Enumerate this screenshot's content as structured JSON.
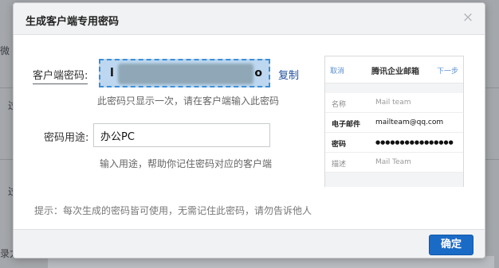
{
  "background": {
    "fragments": [
      "微",
      "过",
      "过",
      "录力"
    ],
    "bottom_texts": [
      "",
      "",
      ""
    ]
  },
  "dialog": {
    "title": "生成客户端专用密码",
    "close_glyph": "×",
    "password": {
      "label": "客户端密码:",
      "visible_first": "l",
      "visible_last": "o",
      "copy_label": "复制",
      "hint": "此密码只显示一次，请在客户端输入此密码"
    },
    "purpose": {
      "label": "密码用途:",
      "value": "办公PC",
      "hint": "输入用途，帮助你记住密码对应的客户端"
    },
    "tip": "提示：每次生成的密码皆可使用，无需记住此密码，请勿告诉他人",
    "ok_label": "确定"
  },
  "preview": {
    "cancel": "取消",
    "title": "腾讯企业邮箱",
    "next": "下一步",
    "rows": [
      {
        "key": "名称",
        "value": "Mail team"
      },
      {
        "key": "电子邮件",
        "value": "mailteam@qq.com"
      },
      {
        "key": "密码",
        "value": "●●●●●●●●●●●●●●●●"
      },
      {
        "key": "描述",
        "value": "Mail Team"
      }
    ]
  },
  "colors": {
    "primary": "#1a6bc6",
    "link": "#1f4f9e",
    "highlight": "#bcd7ef"
  }
}
